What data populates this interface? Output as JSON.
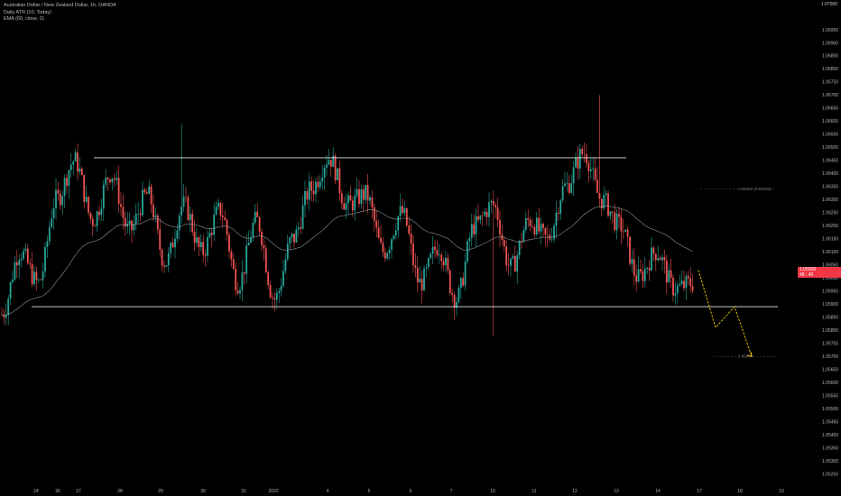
{
  "legend": {
    "title": "Australian Dollar / New Zealand Dollar, 1h, OANDA",
    "atr": "Daily ATR (10, Today)",
    "ema": "EMA (60, close, 0)"
  },
  "current_price": {
    "value": "1.05929",
    "sub": "48 : 40"
  },
  "top_price_label": "1.07000",
  "colors": {
    "up": "#26a69a",
    "down": "#ef5350",
    "ema": "#9aa0a6",
    "level": "#e6e6e6",
    "projection": "#f5d000",
    "axis_text": "#b2b5be",
    "price_tag": "#f23645"
  },
  "chart_data": {
    "type": "candlestick",
    "title": "Australian Dollar / New Zealand Dollar, 1h, OANDA",
    "ylim": [
      1.052,
      1.0705
    ],
    "y_ticks": [
      "1.05250",
      "1.05300",
      "1.05350",
      "1.05400",
      "1.05450",
      "1.05500",
      "1.05550",
      "1.05600",
      "1.05650",
      "1.05700",
      "1.05750",
      "1.05800",
      "1.05850",
      "1.05900",
      "1.05950",
      "1.06000",
      "1.06050",
      "1.06100",
      "1.06150",
      "1.06200",
      "1.06250",
      "1.06300",
      "1.06350",
      "1.06400",
      "1.06450",
      "1.06500",
      "1.06550",
      "1.06600",
      "1.06650",
      "1.06700",
      "1.06750",
      "1.06800",
      "1.06850",
      "1.06900",
      "1.06950"
    ],
    "x_ticks": [
      "24",
      "26",
      "27",
      "28",
      "29",
      "30",
      "31",
      "2022",
      "4",
      "5",
      "6",
      "7",
      "10",
      "11",
      "12",
      "13",
      "14",
      "17",
      "18",
      "19"
    ],
    "resistance": 1.0646,
    "support": 1.0589,
    "atr_level": {
      "price": 1.0634,
      "label": "1.06333 (0.00433)"
    },
    "target_level": {
      "price": 1.057,
      "label": "1.05694"
    },
    "projection_path": [
      1.0603,
      1.0581,
      1.0589,
      1.057
    ],
    "projection_x": [
      "17",
      "17.5",
      "18",
      "18.5"
    ],
    "swings": [
      1.0586,
      1.061,
      1.0598,
      1.063,
      1.0645,
      1.0622,
      1.064,
      1.0618,
      1.0632,
      1.0606,
      1.0628,
      1.061,
      1.0626,
      1.0598,
      1.0622,
      1.0592,
      1.0615,
      1.0634,
      1.0646,
      1.0628,
      1.0632,
      1.061,
      1.0625,
      1.0598,
      1.0612,
      1.0592,
      1.062,
      1.0628,
      1.0604,
      1.0622,
      1.0615,
      1.0635,
      1.0648,
      1.063,
      1.062,
      1.06,
      1.061,
      1.0596,
      1.0598
    ],
    "spikes": [
      {
        "x": "29.5",
        "high": 1.0659
      },
      {
        "x": "12.6",
        "high": 1.067
      },
      {
        "x": "25",
        "low": 1.0565
      },
      {
        "x": "10",
        "low": 1.0578
      }
    ]
  }
}
